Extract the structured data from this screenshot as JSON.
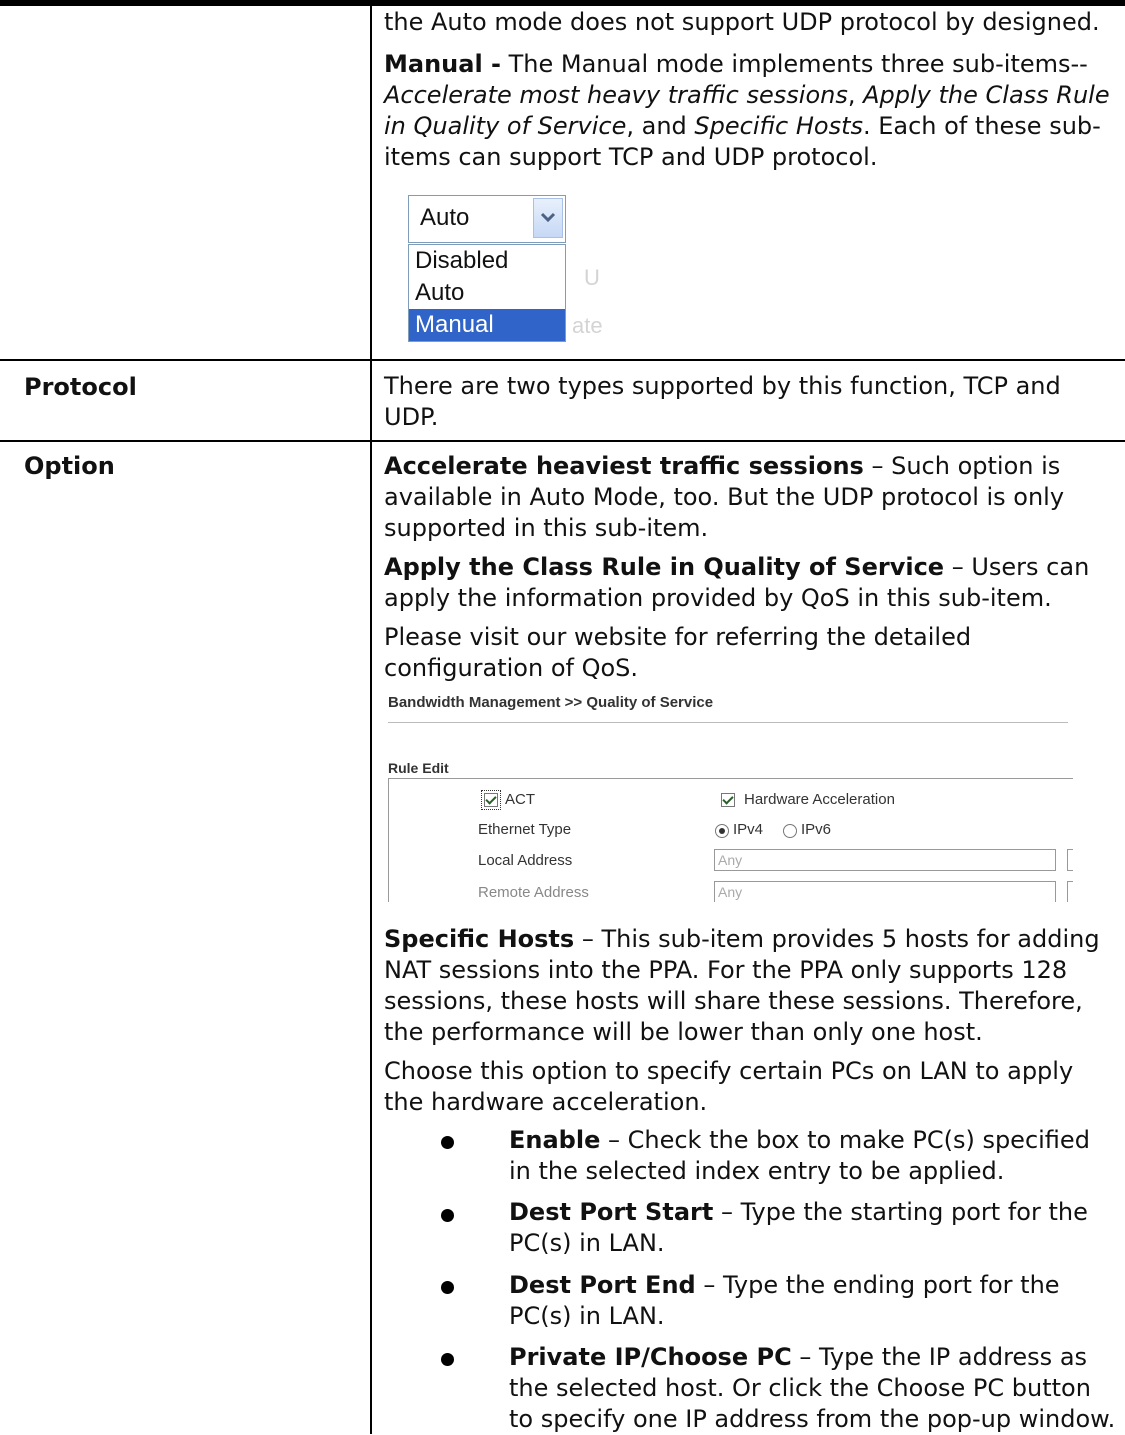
{
  "auto_mode_note": "the Auto mode does not support UDP protocol by designed.",
  "manual": {
    "term": "Manual -",
    "t1": " The Manual mode implements three sub-items--",
    "i1": "Accelerate most heavy traffic sessions",
    "t2": ", ",
    "i2": "Apply the Class Rule in Quality of Service",
    "t3": ", and ",
    "i3": "Specific Hosts",
    "t4": ". Each of these sub-items can support TCP and UDP protocol."
  },
  "mode_dropdown": {
    "selected": "Auto",
    "options": [
      "Disabled",
      "Auto",
      "Manual"
    ],
    "highlighted": "Manual",
    "ghost_1": "U",
    "ghost_2": "ate"
  },
  "protocol": {
    "label": "Protocol",
    "text": "There are two types supported by this function, TCP and UDP."
  },
  "option": {
    "label": "Option",
    "heaviest_term": "Accelerate heaviest traffic sessions",
    "heaviest_text": " – Such option is available in Auto Mode, too. But the UDP protocol is only supported in this sub-item.",
    "class_rule_term": "Apply the Class Rule in Quality of Service",
    "class_rule_text": " – Users can apply the information provided by QoS in this sub-item.",
    "visit_text": "Please visit our website for referring the detailed configuration of QoS.",
    "specific_term": "Specific Hosts",
    "specific_text": " – This sub-item provides 5 hosts for adding NAT sessions into the PPA. For the PPA only supports 128 sessions, these hosts will share these sessions. Therefore, the performance will be lower than only one host.",
    "choose_text": "Choose this option to specify certain PCs on LAN to apply the hardware acceleration."
  },
  "qos_screenshot": {
    "breadcrumb": "Bandwidth Management >> Quality of Service",
    "section": "Rule Edit",
    "act_label": "ACT",
    "hw_accel_label": "Hardware Acceleration",
    "ethernet_type_label": "Ethernet Type",
    "ipv4_label": "IPv4",
    "ipv6_label": "IPv6",
    "local_address_label": "Local Address",
    "local_address_value": "Any",
    "remote_address_label": "Remote Address",
    "remote_address_value": "Any"
  },
  "bullets": [
    {
      "term": "Enable",
      "text": " – Check the box to make PC(s) specified in the selected index entry to be applied."
    },
    {
      "term": "Dest Port Start",
      "text": " – Type the starting port for the PC(s) in LAN."
    },
    {
      "term": "Dest Port End",
      "text": " – Type the ending port for the PC(s) in LAN."
    },
    {
      "term": "Private IP/Choose PC",
      "text": " – Type the IP address as the selected host. Or click the Choose PC button to specify one IP address from the pop-up window."
    }
  ]
}
